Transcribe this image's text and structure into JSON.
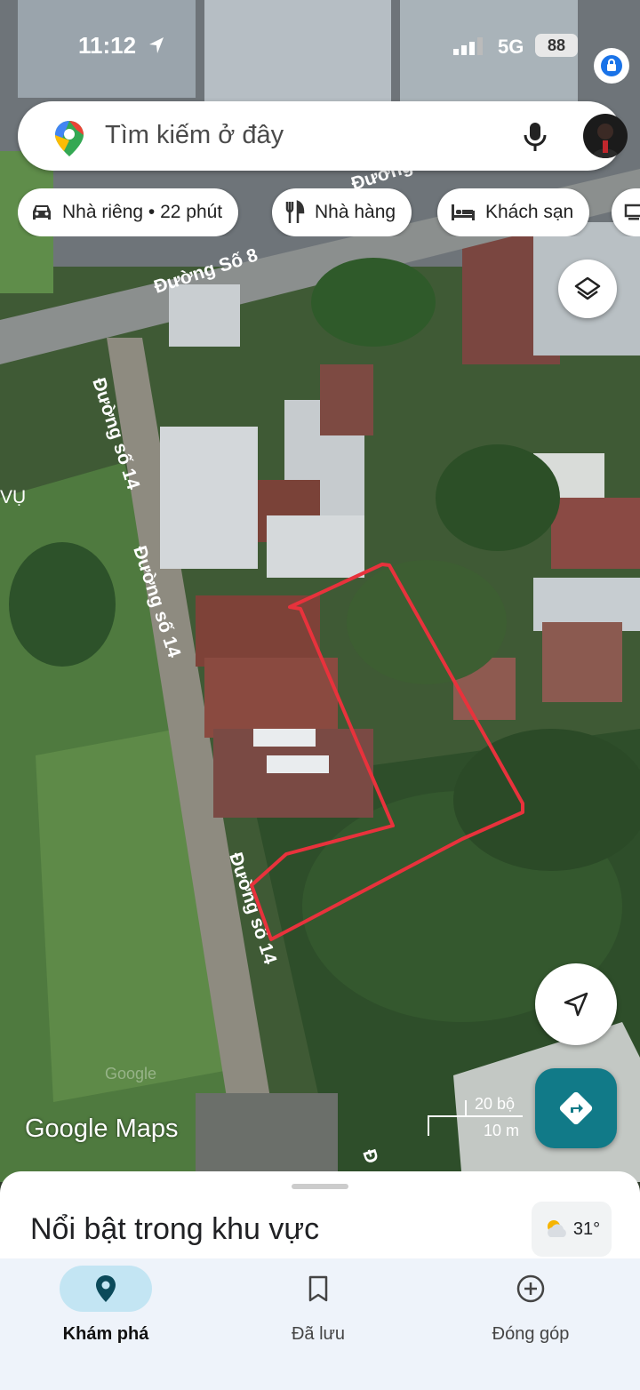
{
  "status_bar": {
    "time": "11:12",
    "network": "5G",
    "battery": "88"
  },
  "search": {
    "placeholder": "Tìm kiếm ở đây"
  },
  "chips": [
    {
      "label": "Nhà riêng • 22 phút",
      "icon": "car-icon"
    },
    {
      "label": "Nhà hàng",
      "icon": "restaurant-icon"
    },
    {
      "label": "Khách sạn",
      "icon": "bed-icon"
    }
  ],
  "map": {
    "road_labels": [
      "Đường Số 8",
      "Đường số 14",
      "Đường số 14",
      "Đường số 14",
      "Đường",
      "VỤ",
      "Đ"
    ],
    "scale": {
      "top": "20 bộ",
      "bottom": "10 m"
    },
    "attribution": "Google Maps",
    "watermark": "Google",
    "marker_color": "#e8323c"
  },
  "sheet": {
    "title": "Nổi bật trong khu vực",
    "weather": "31°"
  },
  "bottom_nav": [
    {
      "label": "Khám phá",
      "icon": "explore-pin-icon",
      "active": true
    },
    {
      "label": "Đã lưu",
      "icon": "bookmark-icon",
      "active": false
    },
    {
      "label": "Đóng góp",
      "icon": "add-circle-icon",
      "active": false
    }
  ],
  "colors": {
    "accent": "#117a88",
    "nav_bg": "#eef3fa",
    "nav_active": "#c3e5f3"
  }
}
